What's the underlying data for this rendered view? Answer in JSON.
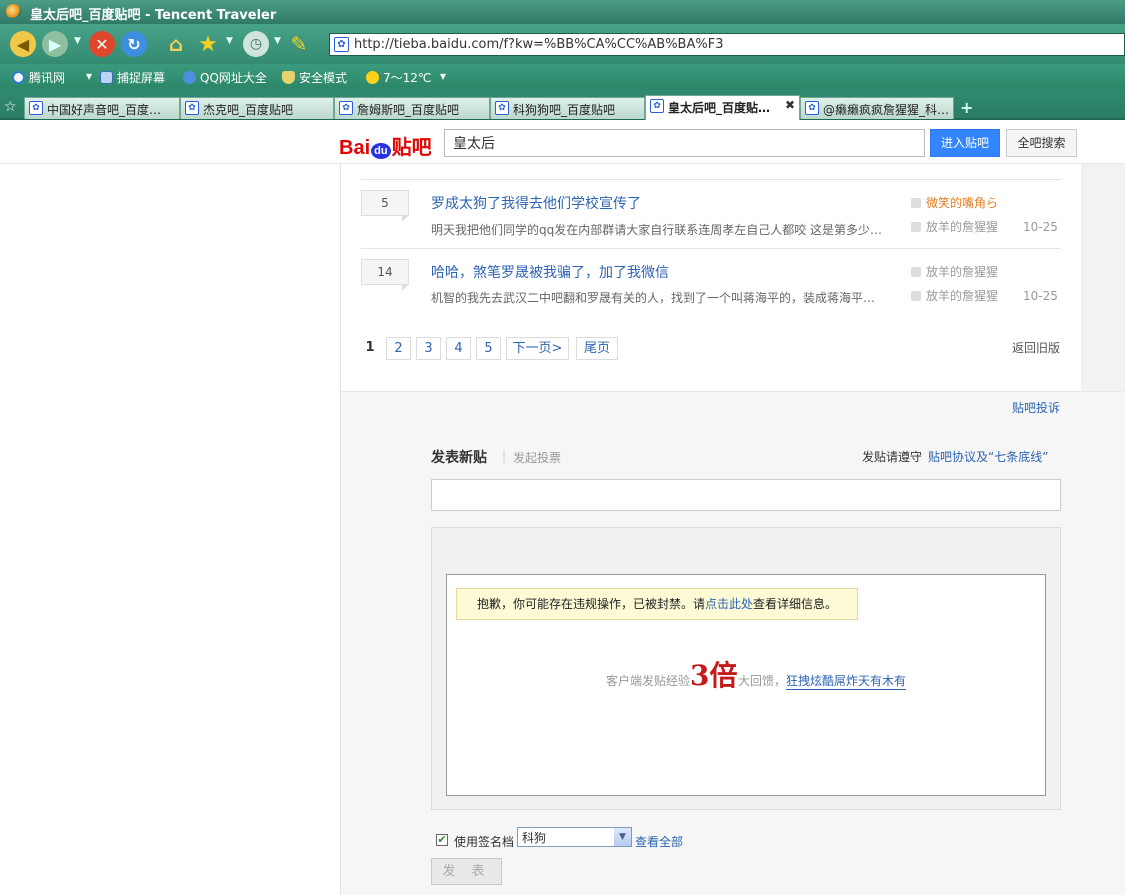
{
  "window": {
    "title": "皇太后吧_百度贴吧 - Tencent Traveler"
  },
  "address_bar": {
    "url": "http://tieba.baidu.com/f?kw=%BB%CA%CC%AB%BA%F3"
  },
  "favorites": [
    {
      "label": "腾讯网"
    },
    {
      "label": "捕捉屏幕"
    },
    {
      "label": "QQ网址大全"
    },
    {
      "label": "安全模式"
    },
    {
      "label": "7～12℃"
    }
  ],
  "tabs": [
    {
      "label": "中国好声音吧_百度…"
    },
    {
      "label": "杰克吧_百度贴吧"
    },
    {
      "label": "詹姆斯吧_百度贴吧"
    },
    {
      "label": "科狗狗吧_百度贴吧"
    },
    {
      "label": "皇太后吧_百度贴…",
      "active": true
    },
    {
      "label": "@癞癞疯疯詹猩猩_科…"
    }
  ],
  "header": {
    "logo_bai": "Bai",
    "logo_du": "du",
    "logo_tieba": "贴吧",
    "search_value": "皇太后",
    "enter_button": "进入贴吧",
    "global_search_button": "全吧搜索"
  },
  "threads": [
    {
      "reply_count": "5",
      "title": "罗成太狗了我得去他们学校宣传了",
      "abstract": "明天我把他们同学的qq发在内部群请大家自行联系连周孝左自己人都咬  这是第多少…",
      "author": "微笑的嘴角ら",
      "last_reply_user": "放羊的詹猩猩",
      "date": "10-25"
    },
    {
      "reply_count": "14",
      "title": "哈哈，煞笔罗晟被我骗了，加了我微信",
      "abstract": "机智的我先去武汉二中吧翻和罗晟有关的人，找到了一个叫蒋海平的，装成蒋海平…",
      "author": "放羊的詹猩猩",
      "last_reply_user": "放羊的詹猩猩",
      "date": "10-25"
    }
  ],
  "pagination": {
    "pages": [
      "1",
      "2",
      "3",
      "4",
      "5"
    ],
    "next": "下一页>",
    "last": "尾页",
    "old_version": "返回旧版"
  },
  "post": {
    "complaint_link": "贴吧投诉",
    "heading": "发表新贴",
    "separator": "|",
    "vote_link": "发起投票",
    "rules_label": "发贴请遵守",
    "rules_link": "贴吧协议及“七条底线”",
    "ban_text_a": "抱歉，你可能存在违规操作，已被封禁。请",
    "ban_link": "点击此处",
    "ban_text_b": "查看详细信息。",
    "promo_a": "客户端发贴经验",
    "promo_big": "3倍",
    "promo_b": "大回馈，",
    "promo_link": "狂拽炫酷屌炸天有木有",
    "signature_label": "使用签名档",
    "signature_value": "科狗",
    "view_all": "查看全部",
    "submit": "发 表"
  }
}
